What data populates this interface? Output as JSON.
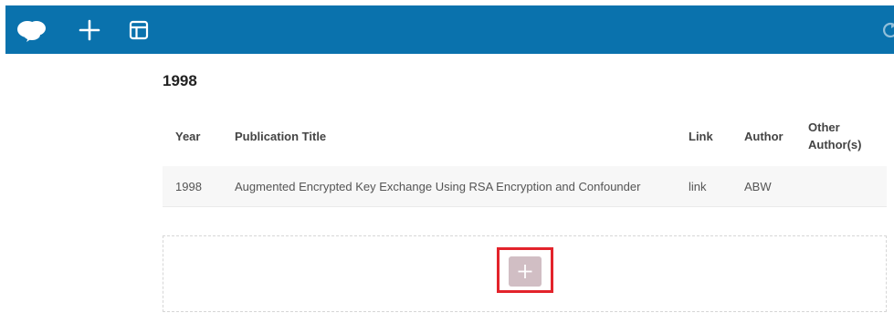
{
  "toolbar": {
    "icons": [
      "cloud-logo-icon",
      "add-icon",
      "layout-icon",
      "refresh-icon"
    ],
    "color": "#0a72ad"
  },
  "section": {
    "title": "1998"
  },
  "table": {
    "headers": {
      "year": "Year",
      "title": "Publication Title",
      "link": "Link",
      "author": "Author",
      "other_authors_line1": "Other",
      "other_authors_line2": "Author(s)"
    },
    "rows": [
      {
        "year": "1998",
        "title": "Augmented Encrypted Key Exchange Using RSA Encryption and Confounder",
        "link": "link",
        "author": "ABW",
        "other_authors": ""
      }
    ]
  },
  "dropzone": {
    "button_icon": "plus-icon",
    "highlight_color": "#e3232b"
  }
}
